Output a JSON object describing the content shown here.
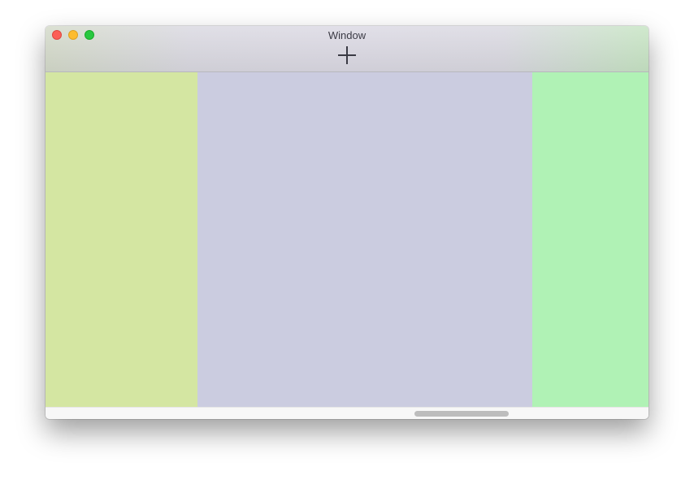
{
  "window": {
    "title": "Window"
  },
  "titlebar": {
    "buttons": [
      "close",
      "minimize",
      "zoom"
    ],
    "add_button_icon": "plus-icon"
  },
  "colors": {
    "close": "#fc5f57",
    "minimize": "#fdbc2e",
    "zoom": "#28c840",
    "left_pane": "#d4e6a2",
    "center_pane": "#cbcce0",
    "right_pane": "#b0f2b5"
  }
}
